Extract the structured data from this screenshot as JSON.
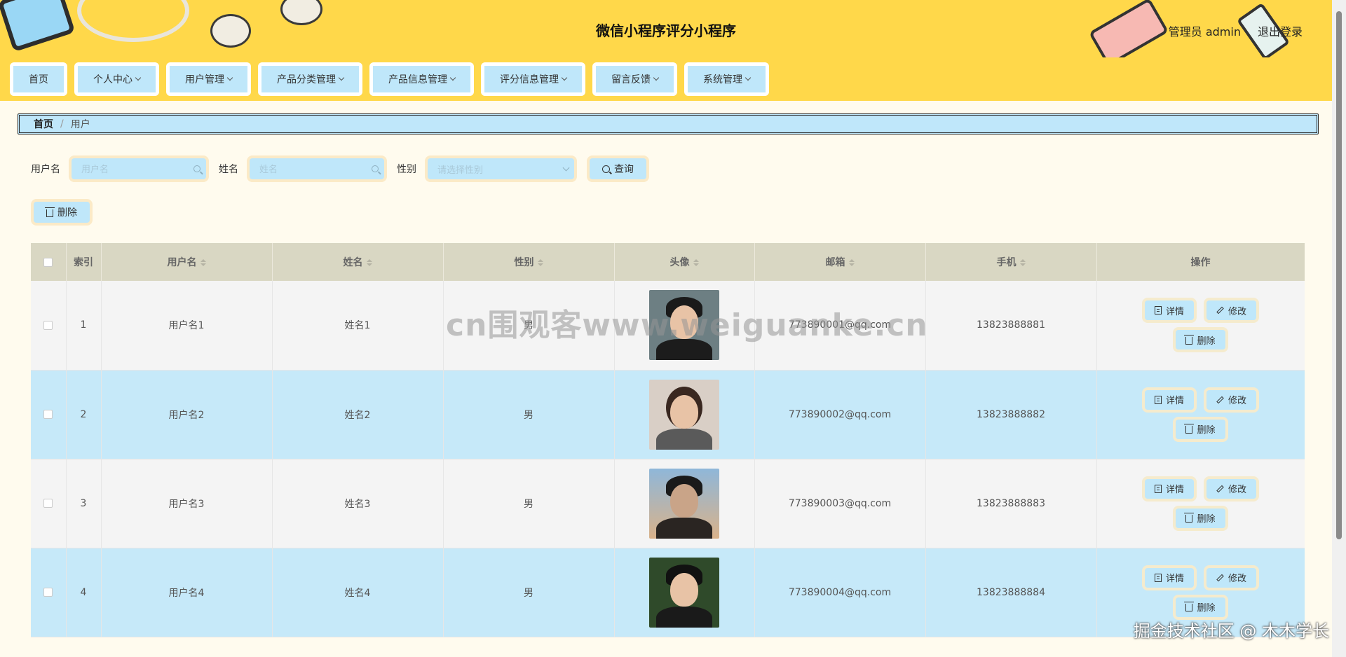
{
  "header": {
    "title": "微信小程序评分小程序",
    "user": "管理员 admin",
    "logout": "退出登录"
  },
  "nav": [
    {
      "label": "首页",
      "dropdown": false
    },
    {
      "label": "个人中心",
      "dropdown": true
    },
    {
      "label": "用户管理",
      "dropdown": true
    },
    {
      "label": "产品分类管理",
      "dropdown": true
    },
    {
      "label": "产品信息管理",
      "dropdown": true
    },
    {
      "label": "评分信息管理",
      "dropdown": true
    },
    {
      "label": "留言反馈",
      "dropdown": true
    },
    {
      "label": "系统管理",
      "dropdown": true
    }
  ],
  "breadcrumb": {
    "home": "首页",
    "current": "用户"
  },
  "search": {
    "username_label": "用户名",
    "username_placeholder": "用户名",
    "name_label": "姓名",
    "name_placeholder": "姓名",
    "gender_label": "性别",
    "gender_placeholder": "请选择性别",
    "query_button": "查询"
  },
  "delete_button": "删除",
  "table": {
    "headers": {
      "index": "索引",
      "username": "用户名",
      "name": "姓名",
      "gender": "性别",
      "avatar": "头像",
      "email": "邮箱",
      "phone": "手机",
      "actions": "操作"
    },
    "rows": [
      {
        "index": "1",
        "username": "用户名1",
        "name": "姓名1",
        "gender": "男",
        "email": "773890001@qq.com",
        "phone": "13823888881"
      },
      {
        "index": "2",
        "username": "用户名2",
        "name": "姓名2",
        "gender": "男",
        "email": "773890002@qq.com",
        "phone": "13823888882"
      },
      {
        "index": "3",
        "username": "用户名3",
        "name": "姓名3",
        "gender": "男",
        "email": "773890003@qq.com",
        "phone": "13823888883"
      },
      {
        "index": "4",
        "username": "用户名4",
        "name": "姓名4",
        "gender": "男",
        "email": "773890004@qq.com",
        "phone": "13823888884"
      }
    ],
    "actions": {
      "detail": "详情",
      "edit": "修改",
      "delete": "删除"
    }
  },
  "watermarks": {
    "center": "cn围观客www.weiguanke.cn",
    "corner": "掘金技术社区 @ 木木学长"
  }
}
